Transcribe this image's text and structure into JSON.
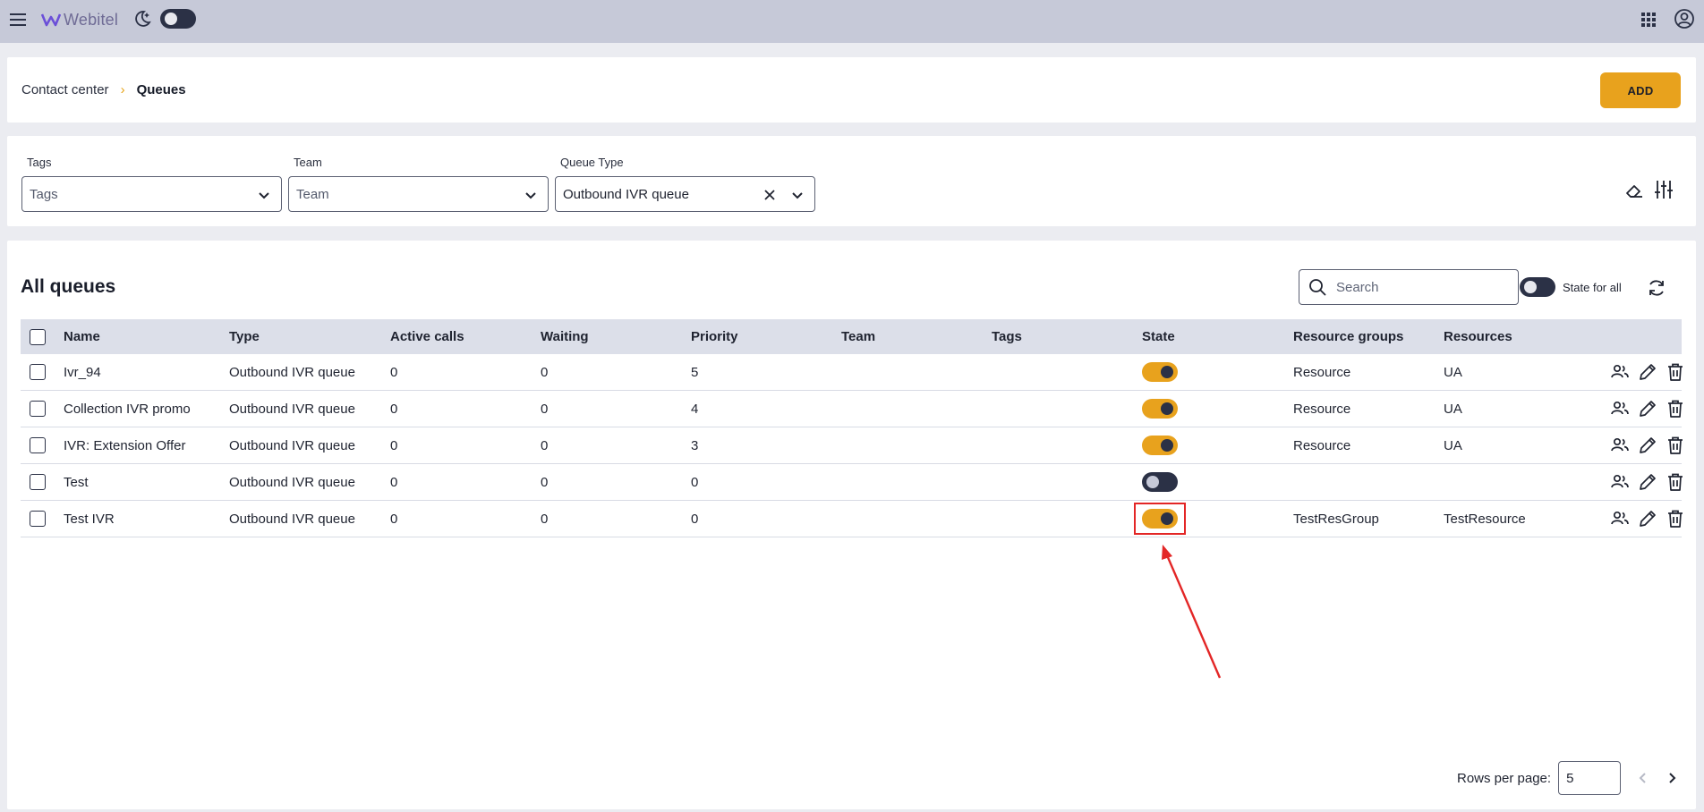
{
  "topbar": {
    "logo_text": "Webitel",
    "icons": [
      "menu-icon",
      "webitel-logo-icon",
      "moon-icon",
      "apps-grid-icon",
      "account-icon"
    ],
    "theme_toggle_on": false
  },
  "breadcrumb": {
    "parent": "Contact center",
    "separator": "›",
    "current": "Queues"
  },
  "header": {
    "add_label": "ADD"
  },
  "filters": {
    "tags": {
      "label": "Tags",
      "placeholder": "Tags"
    },
    "team": {
      "label": "Team",
      "placeholder": "Team"
    },
    "queue_type": {
      "label": "Queue Type",
      "value": "Outbound IVR queue"
    }
  },
  "table": {
    "title": "All queues",
    "search_placeholder": "Search",
    "state_for_all_label": "State for all",
    "columns": [
      "Name",
      "Type",
      "Active calls",
      "Waiting",
      "Priority",
      "Team",
      "Tags",
      "State",
      "Resource groups",
      "Resources"
    ],
    "rows": [
      {
        "name": "Ivr_94",
        "type": "Outbound IVR queue",
        "active_calls": "0",
        "waiting": "0",
        "priority": "5",
        "team": "",
        "tags": "",
        "state": true,
        "resource_groups": "Resource",
        "resources": "UA"
      },
      {
        "name": "Collection IVR promo",
        "type": "Outbound IVR queue",
        "active_calls": "0",
        "waiting": "0",
        "priority": "4",
        "team": "",
        "tags": "",
        "state": true,
        "resource_groups": "Resource",
        "resources": "UA"
      },
      {
        "name": "IVR: Extension Offer",
        "type": "Outbound IVR queue",
        "active_calls": "0",
        "waiting": "0",
        "priority": "3",
        "team": "",
        "tags": "",
        "state": true,
        "resource_groups": "Resource",
        "resources": "UA"
      },
      {
        "name": "Test",
        "type": "Outbound IVR queue",
        "active_calls": "0",
        "waiting": "0",
        "priority": "0",
        "team": "",
        "tags": "",
        "state": false,
        "resource_groups": "",
        "resources": ""
      },
      {
        "name": "Test IVR",
        "type": "Outbound IVR queue",
        "active_calls": "0",
        "waiting": "0",
        "priority": "0",
        "team": "",
        "tags": "",
        "state": true,
        "resource_groups": "TestResGroup",
        "resources": "TestResource"
      }
    ],
    "row_action_icons": [
      "members-icon",
      "edit-icon",
      "delete-icon"
    ]
  },
  "pagination": {
    "rows_per_page_label": "Rows per page:",
    "rows_per_page_value": "5"
  },
  "colors": {
    "accent": "#e8a21d",
    "dark": "#2b3146",
    "topbar": "#c6c9d8",
    "annotation": "#e32626"
  }
}
